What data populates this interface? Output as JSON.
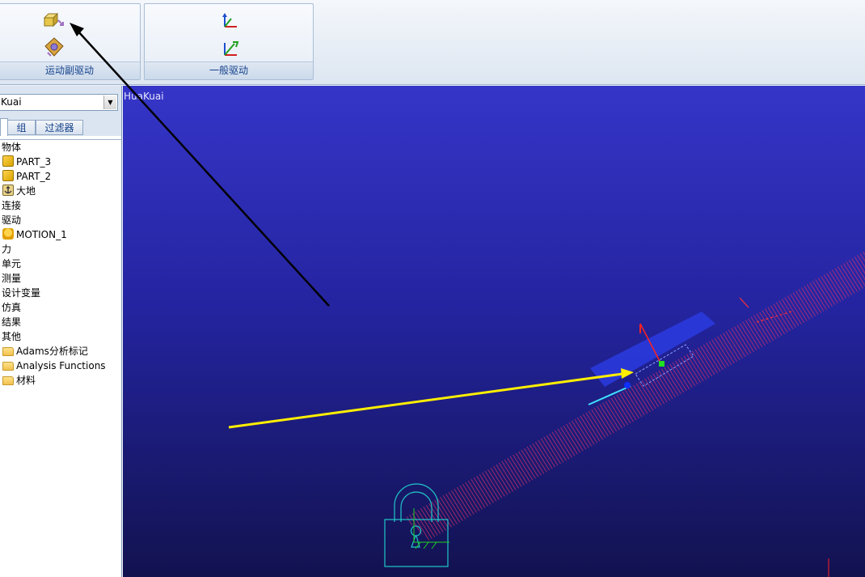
{
  "ribbon": {
    "groups": [
      {
        "label": "运动副驱动",
        "icon": "joint-motion-icon"
      },
      {
        "label": "一般驱动",
        "icon": "general-motion-icon"
      }
    ]
  },
  "browser": {
    "model_select_value": "Kuai",
    "tabs": [
      "",
      "组",
      "过滤器"
    ],
    "tree": [
      {
        "label": "物体",
        "level": 0
      },
      {
        "label": "PART_3",
        "level": 1,
        "icon": "part-cube-icon"
      },
      {
        "label": "PART_2",
        "level": 1,
        "icon": "part-cube-icon"
      },
      {
        "label": "大地",
        "level": 1,
        "icon": "ground-anchor-icon"
      },
      {
        "label": "连接",
        "level": 0
      },
      {
        "label": "驱动",
        "level": 0
      },
      {
        "label": "MOTION_1",
        "level": 1,
        "icon": "motion-icon"
      },
      {
        "label": "力",
        "level": 0
      },
      {
        "label": "单元",
        "level": 0
      },
      {
        "label": "测量",
        "level": 0
      },
      {
        "label": "设计变量",
        "level": 0
      },
      {
        "label": "仿真",
        "level": 0
      },
      {
        "label": "结果",
        "level": 0
      },
      {
        "label": "其他",
        "level": 0
      },
      {
        "label": "Adams分析标记",
        "level": 1,
        "icon": "folder-icon"
      },
      {
        "label": "Analysis Functions",
        "level": 1,
        "icon": "folder-icon"
      },
      {
        "label": "材料",
        "level": 1,
        "icon": "folder-icon"
      }
    ]
  },
  "viewport": {
    "model_name": "HuaKuai",
    "background_top": "#3535c8",
    "background_bottom": "#121250"
  },
  "colors": {
    "ribbon_label": "#15428b",
    "incline": "#c0306a",
    "slider": "#1e2fd6",
    "annotation_arrow_black": "#000000",
    "annotation_arrow_yellow": "#ffee00"
  }
}
